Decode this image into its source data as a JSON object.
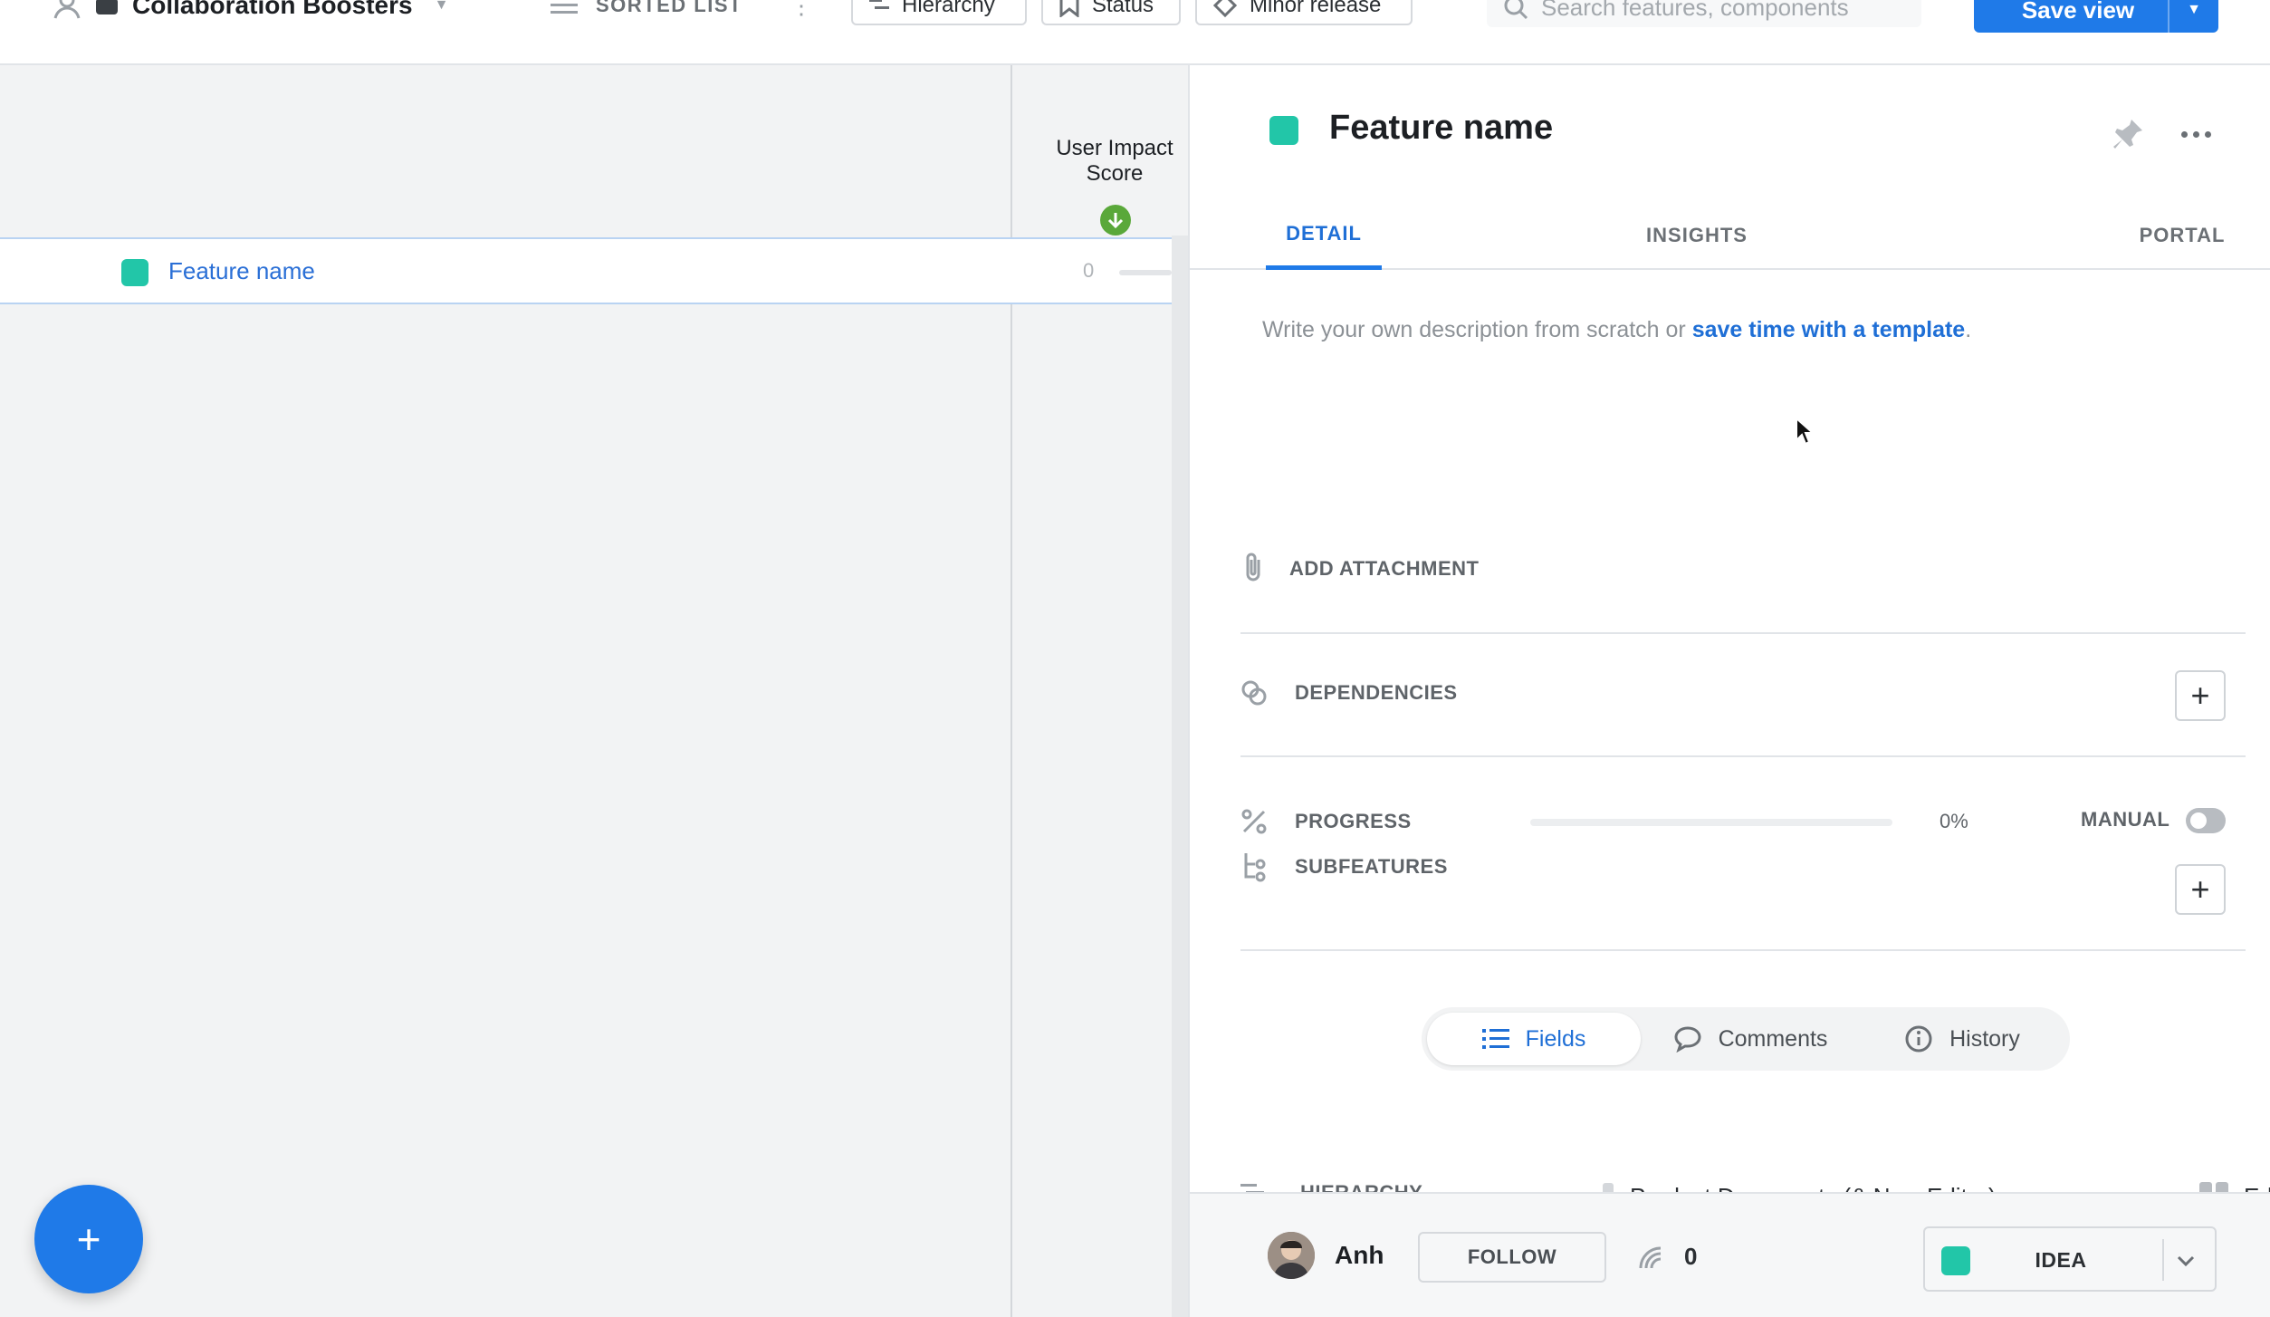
{
  "topbar": {
    "workspace": "Collaboration Boosters",
    "view_type": "SORTED LIST",
    "filters": [
      "Hierarchy",
      "Status",
      "Minor release"
    ],
    "search_placeholder": "Search features, components",
    "save_view": "Save view"
  },
  "list": {
    "column_header": "User Impact Score",
    "rows": [
      {
        "name": "Feature name",
        "score": "0",
        "color": "#22c6a8"
      }
    ]
  },
  "detail": {
    "title": "Feature name",
    "tabs": [
      "DETAIL",
      "INSIGHTS",
      "PORTAL"
    ],
    "active_tab": "DETAIL",
    "description_prefix": "Write your own description from scratch or ",
    "description_link": "save time with a template",
    "description_suffix": ".",
    "add_attachment": "ADD ATTACHMENT",
    "dependencies": "DEPENDENCIES",
    "progress": {
      "label": "PROGRESS",
      "value_text": "0%",
      "value": 0,
      "manual_label": "MANUAL",
      "manual_on": false
    },
    "subfeatures": "SUBFEATURES",
    "segments": [
      "Fields",
      "Comments",
      "History"
    ],
    "active_segment": "Fields",
    "hierarchy": {
      "label": "HIERARCHY",
      "product": "Product Documents (& New Editor)",
      "component": "Editor"
    },
    "footer": {
      "owner": "Anh",
      "follow": "FOLLOW",
      "votes": "0",
      "status": "IDEA",
      "status_color": "#22c6a8"
    }
  },
  "colors": {
    "accent": "#1f7ae8",
    "feature": "#22c6a8",
    "sort_icon": "#5aa83a"
  }
}
